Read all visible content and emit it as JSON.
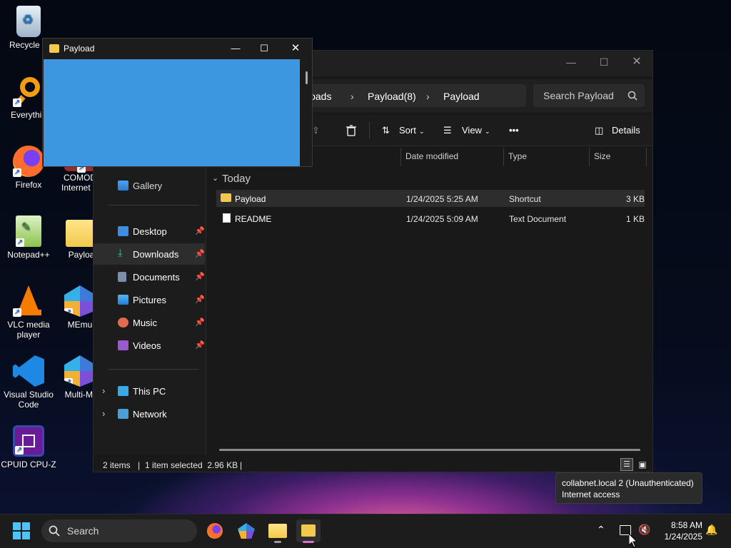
{
  "desktop": {
    "icons": [
      {
        "label": "Recycle B",
        "icon": "recycle-bin-icon"
      },
      {
        "label": "Everythin",
        "icon": "everything-search-icon"
      },
      {
        "label": "Firefox",
        "icon": "firefox-icon"
      },
      {
        "label": "COMOD Internet S",
        "icon": "comodo-icon"
      },
      {
        "label": "Notepad++",
        "icon": "notepadpp-icon"
      },
      {
        "label": "Payloa",
        "icon": "folder-icon"
      },
      {
        "label": "VLC media player",
        "icon": "vlc-icon"
      },
      {
        "label": "MEmu",
        "icon": "memu-icon"
      },
      {
        "label": "Visual Studio Code",
        "icon": "vscode-icon"
      },
      {
        "label": "Multi-MI",
        "icon": "multi-memu-icon"
      },
      {
        "label": "CPUID CPU-Z",
        "icon": "cpuz-icon"
      }
    ]
  },
  "payload_window": {
    "title": "Payload",
    "canvas_color": "#3d97e0"
  },
  "explorer": {
    "breadcrumbs": [
      "loads",
      "Payload(8)",
      "Payload"
    ],
    "search_placeholder": "Search Payload",
    "toolbar": {
      "sort": "Sort",
      "view": "View",
      "more": "•••",
      "details": "Details"
    },
    "sidebar": {
      "gallery": "Gallery",
      "pinned": [
        "Desktop",
        "Downloads",
        "Documents",
        "Pictures",
        "Music",
        "Videos"
      ],
      "this_pc": "This PC",
      "network": "Network"
    },
    "columns": {
      "date": "Date modified",
      "type": "Type",
      "size": "Size"
    },
    "group": "Today",
    "files": [
      {
        "name": "Payload",
        "date": "1/24/2025 5:25 AM",
        "type": "Shortcut",
        "size": "3 KB"
      },
      {
        "name": "README",
        "date": "1/24/2025 5:09 AM",
        "type": "Text Document",
        "size": "1 KB"
      }
    ],
    "status": {
      "items": "2 items",
      "selected": "1 item selected  2.96 KB"
    }
  },
  "tooltip": {
    "line1": "collabnet.local 2 (Unauthenticated)",
    "line2": "Internet access"
  },
  "taskbar": {
    "search_label": "Search",
    "time": "8:58 AM",
    "date": "1/24/2025"
  },
  "colors": {
    "accent": "#3d97e0",
    "selection": "#2d2d2d"
  }
}
